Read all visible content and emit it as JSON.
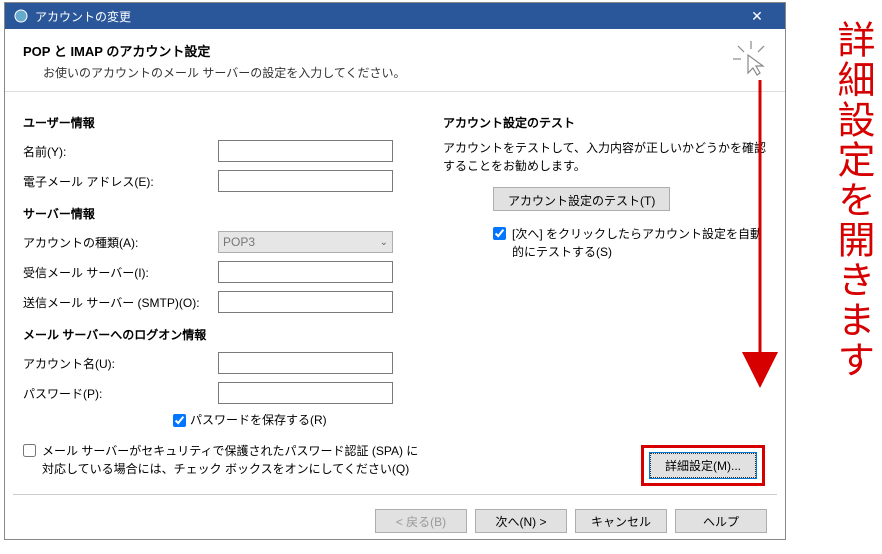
{
  "window": {
    "title": "アカウントの変更"
  },
  "header": {
    "title": "POP と IMAP のアカウント設定",
    "subtitle": "お使いのアカウントのメール サーバーの設定を入力してください。"
  },
  "left": {
    "user_section": "ユーザー情報",
    "name_label": "名前(Y):",
    "email_label": "電子メール アドレス(E):",
    "server_section": "サーバー情報",
    "account_type_label": "アカウントの種類(A):",
    "account_type_value": "POP3",
    "incoming_label": "受信メール サーバー(I):",
    "outgoing_label": "送信メール サーバー (SMTP)(O):",
    "logon_section": "メール サーバーへのログオン情報",
    "account_name_label": "アカウント名(U):",
    "password_label": "パスワード(P):",
    "save_password_label": "パスワードを保存する(R)",
    "spa_label": "メール サーバーがセキュリティで保護されたパスワード認証 (SPA) に対応している場合には、チェック ボックスをオンにしてください(Q)"
  },
  "right": {
    "test_section": "アカウント設定のテスト",
    "test_desc": "アカウントをテストして、入力内容が正しいかどうかを確認することをお勧めします。",
    "test_button": "アカウント設定のテスト(T)",
    "auto_test_label": "[次へ] をクリックしたらアカウント設定を自動的にテストする(S)",
    "advanced_button": "詳細設定(M)..."
  },
  "footer": {
    "back": "< 戻る(B)",
    "next": "次へ(N) >",
    "cancel": "キャンセル",
    "help": "ヘルプ"
  },
  "annotation": "詳細設定を開きます"
}
